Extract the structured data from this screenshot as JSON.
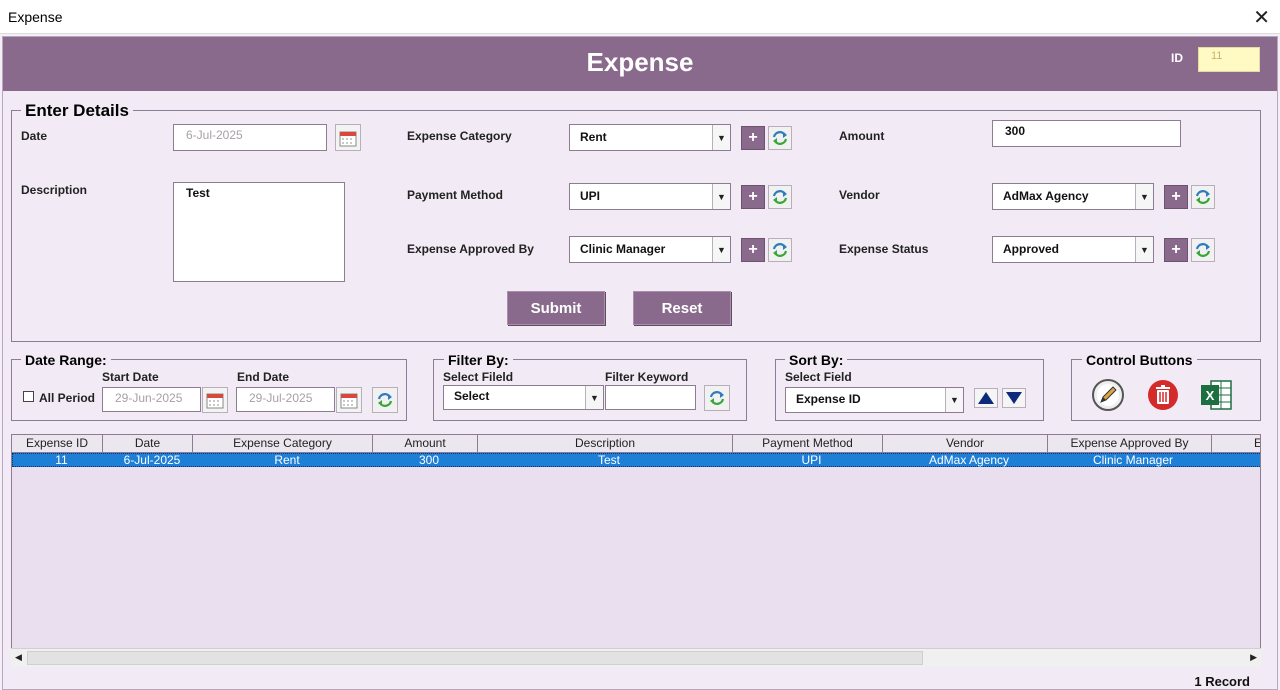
{
  "window": {
    "title": "Expense",
    "close_symbol": "✕"
  },
  "header": {
    "title": "Expense",
    "id_label": "ID",
    "id_value": "11"
  },
  "enter_details": {
    "title": "Enter Details",
    "date_label": "Date",
    "date_value": "6-Jul-2025",
    "description_label": "Description",
    "description_value": "Test",
    "expense_category_label": "Expense Category",
    "expense_category_value": "Rent",
    "payment_method_label": "Payment Method",
    "payment_method_value": "UPI",
    "approved_by_label": "Expense Approved By",
    "approved_by_value": "Clinic Manager",
    "amount_label": "Amount",
    "amount_value": "300",
    "vendor_label": "Vendor",
    "vendor_value": "AdMax Agency",
    "status_label": "Expense Status",
    "status_value": "Approved",
    "plus_symbol": "+",
    "submit_label": "Submit",
    "reset_label": "Reset"
  },
  "date_range": {
    "title": "Date Range:",
    "all_period_label": "All Period",
    "start_label": "Start Date",
    "start_value": "29-Jun-2025",
    "end_label": "End Date",
    "end_value": "29-Jul-2025"
  },
  "filter_by": {
    "title": "Filter By:",
    "field_label": "Select Fileld",
    "field_value": "Select",
    "keyword_label": "Filter Keyword",
    "keyword_value": ""
  },
  "sort_by": {
    "title": "Sort By:",
    "field_label": "Select Field",
    "field_value": "Expense ID"
  },
  "control_buttons": {
    "title": "Control Buttons"
  },
  "grid": {
    "columns": [
      "Expense ID",
      "Date",
      "Expense Category",
      "Amount",
      "Description",
      "Payment Method",
      "Vendor",
      "Expense Approved By",
      "E"
    ],
    "rows": [
      [
        "11",
        "6-Jul-2025",
        "Rent",
        "300",
        "Test",
        "UPI",
        "AdMax Agency",
        "Clinic Manager",
        ""
      ]
    ]
  },
  "footer": {
    "record_count": "1 Record"
  },
  "colors": {
    "header_purple": "#8a6a8c",
    "background": "#f2eaf4",
    "selected_row": "#1e7fd6",
    "id_box": "#fff9c4"
  },
  "icons": [
    "calendar-icon",
    "refresh-icon",
    "edit-icon",
    "delete-icon",
    "excel-icon",
    "sort-up-icon",
    "sort-down-icon",
    "dropdown-arrow-icon",
    "close-icon"
  ]
}
